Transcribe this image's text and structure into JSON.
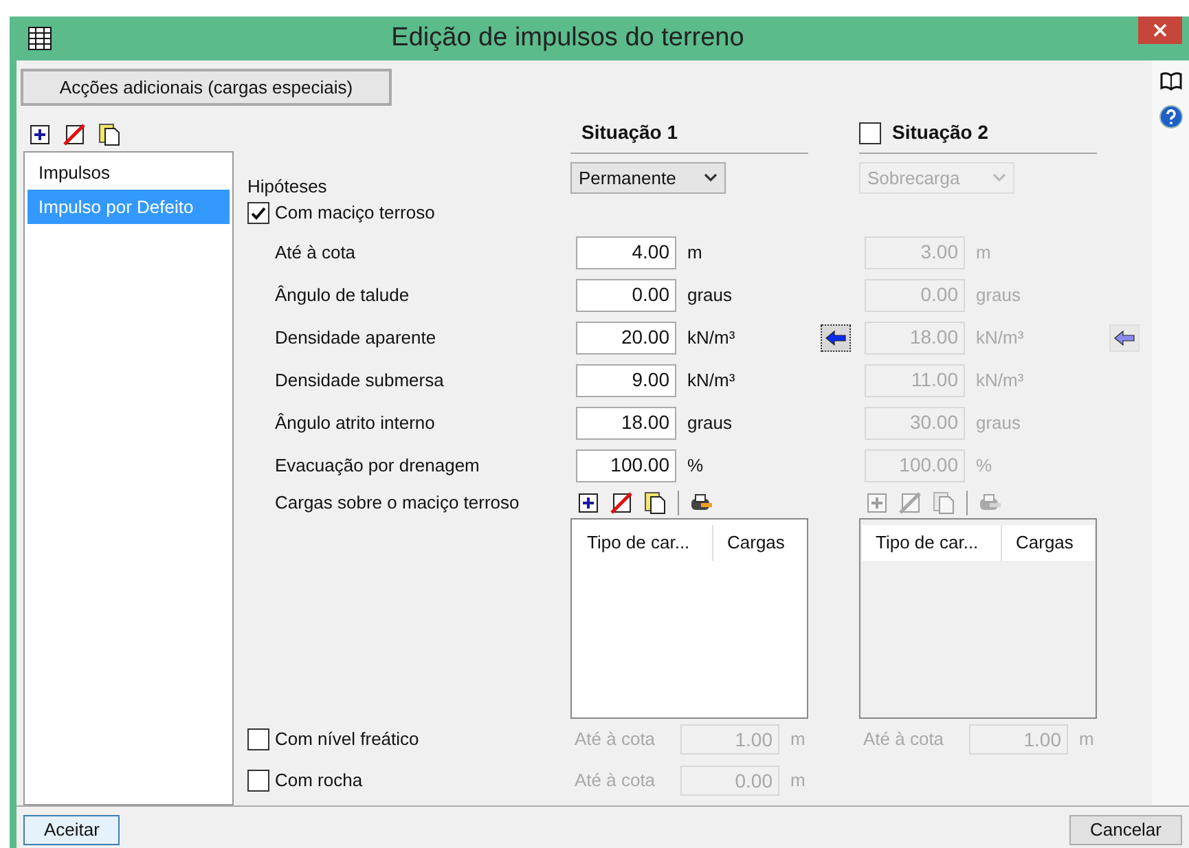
{
  "window": {
    "title": "Edição de impulsos do terreno"
  },
  "top_button": "Acções adicionais (cargas especiais)",
  "sidebar": {
    "items": [
      {
        "label": "Impulsos",
        "selected": false
      },
      {
        "label": "Impulso por Defeito",
        "selected": true
      }
    ]
  },
  "hypotheses_label": "Hipóteses",
  "soil_option": {
    "label": "Com maciço terroso",
    "checked": true
  },
  "field_labels": [
    "Até à cota",
    "Ângulo de talude",
    "Densidade aparente",
    "Densidade submersa",
    "Ângulo atrito interno",
    "Evacuação por drenagem"
  ],
  "loads_label": "Cargas sobre o maciço terroso",
  "situations": [
    {
      "title": "Situação 1",
      "hypothesis": "Permanente",
      "disabled": false,
      "fields": [
        {
          "value": "4.00",
          "unit": "m"
        },
        {
          "value": "0.00",
          "unit": "graus"
        },
        {
          "value": "20.00",
          "unit": "kN/m³",
          "arrow": true
        },
        {
          "value": "9.00",
          "unit": "kN/m³"
        },
        {
          "value": "18.00",
          "unit": "graus"
        },
        {
          "value": "100.00",
          "unit": "%"
        }
      ],
      "table": {
        "columns": [
          "Tipo de car...",
          "Cargas"
        ]
      }
    },
    {
      "title": "Situação 2",
      "checked": false,
      "hypothesis": "Sobrecarga",
      "disabled": true,
      "fields": [
        {
          "value": "3.00",
          "unit": "m"
        },
        {
          "value": "0.00",
          "unit": "graus"
        },
        {
          "value": "18.00",
          "unit": "kN/m³",
          "arrow": true
        },
        {
          "value": "11.00",
          "unit": "kN/m³"
        },
        {
          "value": "30.00",
          "unit": "graus"
        },
        {
          "value": "100.00",
          "unit": "%"
        }
      ],
      "table": {
        "columns": [
          "Tipo de car...",
          "Cargas"
        ]
      }
    }
  ],
  "bottom_options": [
    {
      "label": "Com nível freático",
      "checked": false,
      "cells": [
        {
          "label": "Até à cota",
          "value": "1.00",
          "unit": "m"
        },
        {
          "label": "Até à cota",
          "value": "1.00",
          "unit": "m"
        }
      ]
    },
    {
      "label": "Com rocha",
      "checked": false,
      "cells": [
        {
          "label": "Até à cota",
          "value": "0.00",
          "unit": "m"
        }
      ]
    }
  ],
  "buttons": [
    {
      "label": "Aceitar",
      "default": true
    },
    {
      "label": "Cancelar",
      "default": false
    }
  ]
}
